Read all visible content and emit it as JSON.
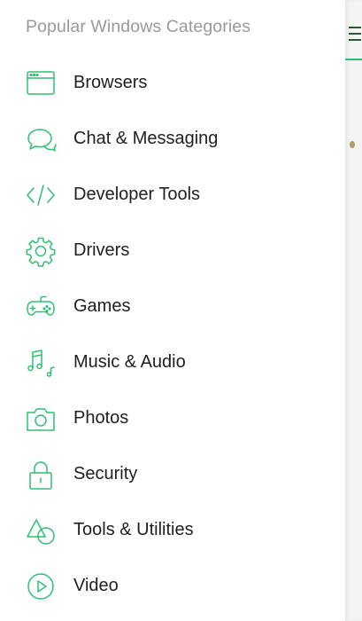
{
  "drawer": {
    "title": "Popular Windows Categories",
    "items": [
      {
        "label": "Browsers",
        "icon": "browser-window-icon"
      },
      {
        "label": "Chat & Messaging",
        "icon": "chat-bubbles-icon"
      },
      {
        "label": "Developer Tools",
        "icon": "code-brackets-icon"
      },
      {
        "label": "Drivers",
        "icon": "gear-icon"
      },
      {
        "label": "Games",
        "icon": "gamepad-icon"
      },
      {
        "label": "Music & Audio",
        "icon": "music-notes-icon"
      },
      {
        "label": "Photos",
        "icon": "camera-icon"
      },
      {
        "label": "Security",
        "icon": "padlock-icon"
      },
      {
        "label": "Tools & Utilities",
        "icon": "shapes-icon"
      },
      {
        "label": "Video",
        "icon": "play-circle-icon"
      }
    ]
  },
  "colors": {
    "accent": "#2fbf71",
    "title_gray": "#9a9a9a",
    "label_text": "#1f1f1f"
  }
}
